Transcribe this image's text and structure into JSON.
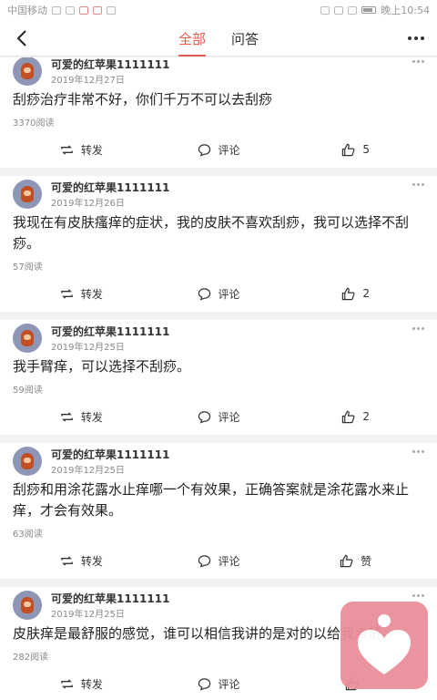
{
  "status_bar": {
    "carrier": "中国移动",
    "time": "晚上10:54"
  },
  "nav": {
    "tabs": [
      {
        "label": "全部",
        "active": true
      },
      {
        "label": "问答",
        "active": false
      }
    ]
  },
  "actions": {
    "forward": "转发",
    "comment": "评论"
  },
  "posts": [
    {
      "author": "可爱的红苹果1111111",
      "date": "2019年12月27日",
      "text": "刮痧治疗非常不好，你们千万不可以去刮痧",
      "reads": "3370阅读",
      "likes": "5"
    },
    {
      "author": "可爱的红苹果1111111",
      "date": "2019年12月26日",
      "text": "我现在有皮肤瘙痒的症状，我的皮肤不喜欢刮痧，我可以选择不刮痧。",
      "reads": "57阅读",
      "likes": "2"
    },
    {
      "author": "可爱的红苹果1111111",
      "date": "2019年12月25日",
      "text": "我手臂痒，可以选择不刮痧。",
      "reads": "59阅读",
      "likes": "2"
    },
    {
      "author": "可爱的红苹果1111111",
      "date": "2019年12月25日",
      "text": "刮痧和用涂花露水止痒哪一个有效果，正确答案就是涂花露水来止痒，才会有效果。",
      "reads": "63阅读",
      "likes": "赞"
    },
    {
      "author": "可爱的红苹果1111111",
      "date": "2019年12月25日",
      "text": "皮肤痒是最舒服的感觉，谁可以相信我讲的是对的以给我点赞。",
      "reads": "282阅读",
      "likes": ""
    }
  ],
  "colors": {
    "accent": "#e85a4f",
    "logo_bg": "#e98f9b"
  }
}
